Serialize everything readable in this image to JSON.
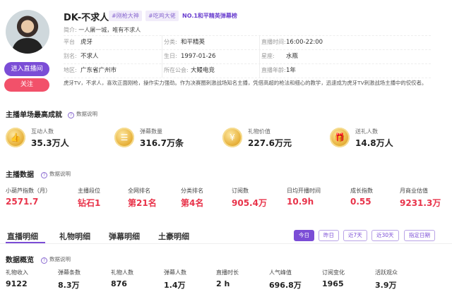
{
  "profile": {
    "name": "DK-不求人",
    "tags": [
      "#刚枪大神",
      "#吃鸡大佬"
    ],
    "rank_tag": "NO.1和平精英弹幕榜",
    "intro_label": "简介:",
    "intro": "一人屠一城，唯有不求人",
    "live_button": "进入直播间",
    "follow_button": "关注",
    "rows": [
      [
        {
          "label": "平台",
          "value": "虎牙"
        },
        {
          "label": "分类:",
          "value": "和平精英"
        },
        {
          "label": "直播时间:",
          "value": "16:00-22:00"
        }
      ],
      [
        {
          "label": "别名:",
          "value": "不求人"
        },
        {
          "label": "生日:",
          "value": "1997-01-26"
        },
        {
          "label": "星座:",
          "value": "水瓶"
        }
      ],
      [
        {
          "label": "地区:",
          "value": "广东省广州市"
        },
        {
          "label": "所在公会:",
          "value": "大鳗电竞"
        },
        {
          "label": "直播年龄:",
          "value": "1年"
        }
      ]
    ],
    "description": "虎牙TV，不求人，喜欢正面刚枪，操作实力强劲。作为决赛圈刺激战场知名主播，凭借高超的枪法和细心的教学，迅速成为虎牙TV刺激战场主播中的佼佼者。"
  },
  "achievements": {
    "title": "主播单场最高成就",
    "help": "数据说明",
    "items": [
      {
        "icon": "like-medal-icon",
        "glyph": "👍",
        "label": "互动人数",
        "value": "35.3万人"
      },
      {
        "icon": "danmu-medal-icon",
        "glyph": "☰",
        "label": "弹幕数量",
        "value": "316.7万条"
      },
      {
        "icon": "gift-value-medal-icon",
        "glyph": "¥",
        "label": "礼物价值",
        "value": "227.6万元"
      },
      {
        "icon": "gift-sender-medal-icon",
        "glyph": "🎁",
        "label": "送礼人数",
        "value": "14.8万人"
      }
    ]
  },
  "stats": {
    "title": "主播数据",
    "help": "数据说明",
    "items": [
      {
        "label": "小葫芦指数（月）",
        "value": "2571.7"
      },
      {
        "label": "主播段位",
        "value": "钻石1"
      },
      {
        "label": "全网排名",
        "value": "第21名"
      },
      {
        "label": "分类排名",
        "value": "第4名"
      },
      {
        "label": "订阅数",
        "value": "905.4万"
      },
      {
        "label": "日均开播时间",
        "value": "10.9h"
      },
      {
        "label": "成长指数",
        "value": "0.55"
      },
      {
        "label": "月商业估值",
        "value": "9231.3万"
      }
    ]
  },
  "tabs": [
    "直播明细",
    "礼物明细",
    "弹幕明细",
    "土豪明细"
  ],
  "ranges": [
    "今日",
    "昨日",
    "近7天",
    "近30天",
    "指定日期"
  ],
  "overview": {
    "title": "数据概览",
    "help": "数据说明",
    "items": [
      {
        "label": "礼物收入",
        "value": "9122"
      },
      {
        "label": "弹幕条数",
        "value": "8.3万"
      },
      {
        "label": "礼物人数",
        "value": "876"
      },
      {
        "label": "弹幕人数",
        "value": "1.4万"
      },
      {
        "label": "直播时长",
        "value": "2 h"
      },
      {
        "label": "人气峰值",
        "value": "696.8万"
      },
      {
        "label": "订阅变化",
        "value": "1965"
      },
      {
        "label": "活跃观众",
        "value": "3.9万"
      }
    ]
  }
}
